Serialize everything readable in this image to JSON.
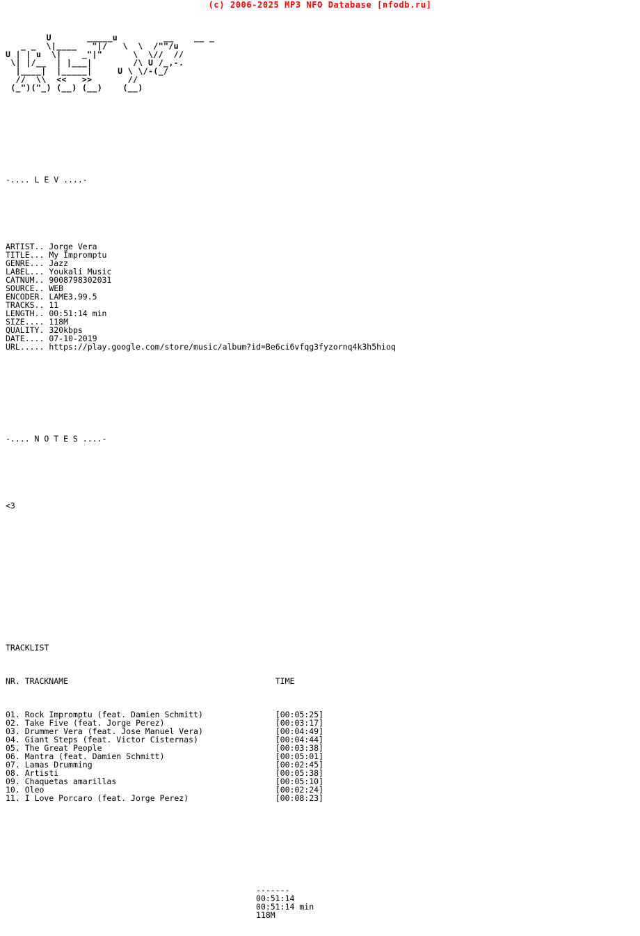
{
  "banner": {
    "text": "(c) 2006-2025 MP3 NFO Database [nfodb.ru]",
    "color": "#FF0000"
  },
  "colors": {
    "background": "#FFFFFF",
    "text": "#000000",
    "banner": "#FF0000"
  },
  "ascii_art": {
    "lines": [
      "        U       _____u         __    __ _",
      "   _ _  \\|____   \"|/   \\  \\  /\"\"/u",
      "U | | u  \\|    _\"|\"      \\  \\//  //",
      " \\| |/__  | |___|        /\\ U /_,-.",
      "  |____|  |_____|     U \\ \\/-(_/",
      "  //  \\\\  <<   >>       //",
      " (_\")(\"_) (__) (__)    (__)"
    ],
    "raw": "ASCII-art logo: L E V"
  },
  "sections": {
    "info_header": "-.... L E V ....-",
    "notes_header": "-.... N O T E S ....-",
    "notes_body": "<3",
    "tracklist_header": "TRACKLIST",
    "tracklist_columns": {
      "nr": "NR.",
      "trackname": "TRACKNAME",
      "time": "TIME"
    },
    "divider": "-------"
  },
  "info": {
    "fields": [
      {
        "label": "ARTIST..",
        "value": "Jorge Vera"
      },
      {
        "label": "TITLE...",
        "value": "My Impromptu"
      },
      {
        "label": "GENRE...",
        "value": "Jazz"
      },
      {
        "label": "LABEL...",
        "value": "Youkali Music"
      },
      {
        "label": "CATNUM..",
        "value": "9008798302031"
      },
      {
        "label": "SOURCE..",
        "value": "WEB"
      },
      {
        "label": "ENCODER.",
        "value": "LAME3.99.5"
      },
      {
        "label": "TRACKS..",
        "value": "11"
      },
      {
        "label": "LENGTH..",
        "value": "00:51:14 min"
      },
      {
        "label": "SIZE....",
        "value": "118M"
      },
      {
        "label": "QUALITY.",
        "value": "320kbps"
      },
      {
        "label": "DATE....",
        "value": "07-10-2019"
      },
      {
        "label": "URL.....",
        "value": "https://play.google.com/store/music/album?id=Be6ci6vfqg3fyzornq4k3h5hioq"
      }
    ]
  },
  "tracks": [
    {
      "nr": "01.",
      "name": "Rock Impromptu (feat. Damien Schmitt)",
      "time": "[00:05:25]"
    },
    {
      "nr": "02.",
      "name": "Take Five (feat. Jorge Perez)",
      "time": "[00:03:17]"
    },
    {
      "nr": "03.",
      "name": "Drummer Vera (feat. Jose Manuel Vera)",
      "time": "[00:04:49]"
    },
    {
      "nr": "04.",
      "name": "Giant Steps (feat. Victor Cisternas)",
      "time": "[00:04:44]"
    },
    {
      "nr": "05.",
      "name": "The Great People",
      "time": "[00:03:38]"
    },
    {
      "nr": "06.",
      "name": "Mantra (feat. Damien Schmitt)",
      "time": "[00:05:01]"
    },
    {
      "nr": "07.",
      "name": "Lamas Drumming",
      "time": "[00:02:45]"
    },
    {
      "nr": "08.",
      "name": "Artisti",
      "time": "[00:05:38]"
    },
    {
      "nr": "09.",
      "name": "Chaquetas amarillas",
      "time": "[00:05:10]"
    },
    {
      "nr": "10.",
      "name": "Oleo",
      "time": "[00:02:24]"
    },
    {
      "nr": "11.",
      "name": "I Love Porcaro (feat. Jorge Perez)",
      "time": "[00:08:23]"
    }
  ],
  "totals": {
    "total_time": "00:51:14",
    "total_time_min": "00:51:14 min",
    "total_size": "118M"
  }
}
